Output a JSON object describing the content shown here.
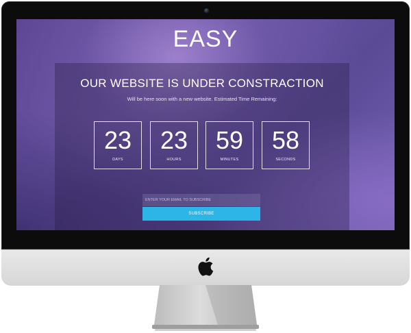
{
  "site": {
    "brand": "EASY",
    "headline": "OUR WEBSITE IS UNDER CONSTRACTION",
    "subline": "Will be here soon with a new website. Estimated Time Remaining:"
  },
  "countdown": [
    {
      "value": "23",
      "label": "DAYS"
    },
    {
      "value": "23",
      "label": "HOURS"
    },
    {
      "value": "59",
      "label": "MINUTES"
    },
    {
      "value": "58",
      "label": "SECONDS"
    }
  ],
  "subscribe": {
    "placeholder": "ENTER YOUR EMAIL TO SUBSCRIBE",
    "button_label": "SUBSCRIBE"
  },
  "colors": {
    "accent": "#2db5e8",
    "background": "#5a4490"
  },
  "icons": {
    "chin_logo": "apple-icon",
    "bezel_camera": "camera-icon"
  }
}
